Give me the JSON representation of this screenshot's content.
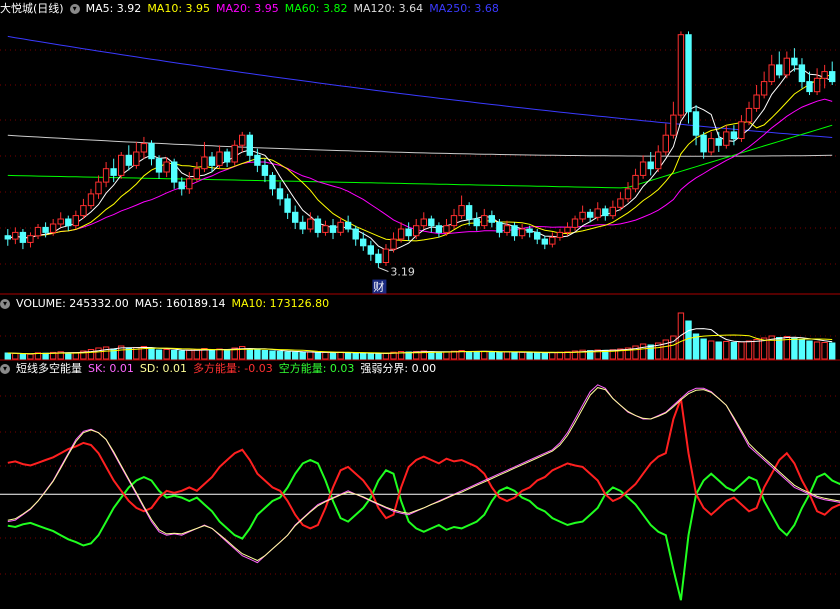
{
  "main": {
    "title": "大悦城(日线)",
    "legend": [
      {
        "label": "MA5: 3.92",
        "color": "#ffffff"
      },
      {
        "label": "MA10: 3.95",
        "color": "#ffff00"
      },
      {
        "label": "MA20: 3.95",
        "color": "#ff00ff"
      },
      {
        "label": "MA60: 3.82",
        "color": "#00ff00"
      },
      {
        "label": "MA120: 3.64",
        "color": "#dddddd"
      },
      {
        "label": "MA250: 3.68",
        "color": "#3a3aff"
      }
    ],
    "low_label": "3.19",
    "cai_label": "财"
  },
  "volume": {
    "title": "VOLUME: 245332.00",
    "ma5": "MA5: 160189.14",
    "ma10": "MA10: 173126.80"
  },
  "indicator": {
    "title": "短线多空能量",
    "sk": "SK: 0.01",
    "sd": "SD: 0.01",
    "duo": "多方能量: -0.03",
    "kong": "空方能量: 0.03",
    "qiang": "强弱分界: 0.00"
  },
  "colors": {
    "up": "#ff3030",
    "down": "#54ffff",
    "ma5": "#ffffff",
    "ma10": "#ffff00",
    "ma20": "#ff00ff",
    "ma60": "#00ff00",
    "ma120": "#cccccc",
    "ma250": "#3a3aff",
    "grid": "#7a0000",
    "duo": "#ff2020",
    "kong": "#20ff20",
    "sk": "#ff66ff",
    "sd": "#ffff99",
    "zero": "#ffffff"
  },
  "chart_data": {
    "type": "candlestick",
    "candles": [
      [
        3.38,
        3.36,
        3.42,
        3.32
      ],
      [
        3.36,
        3.4,
        3.43,
        3.33
      ],
      [
        3.4,
        3.34,
        3.42,
        3.3
      ],
      [
        3.34,
        3.38,
        3.4,
        3.31
      ],
      [
        3.38,
        3.43,
        3.45,
        3.36
      ],
      [
        3.43,
        3.4,
        3.46,
        3.37
      ],
      [
        3.4,
        3.45,
        3.48,
        3.38
      ],
      [
        3.45,
        3.48,
        3.52,
        3.43
      ],
      [
        3.48,
        3.44,
        3.5,
        3.41
      ],
      [
        3.44,
        3.5,
        3.53,
        3.42
      ],
      [
        3.5,
        3.56,
        3.6,
        3.48
      ],
      [
        3.56,
        3.63,
        3.66,
        3.54
      ],
      [
        3.63,
        3.7,
        3.74,
        3.6
      ],
      [
        3.7,
        3.78,
        3.82,
        3.67
      ],
      [
        3.78,
        3.74,
        3.84,
        3.7
      ],
      [
        3.74,
        3.86,
        3.88,
        3.72
      ],
      [
        3.86,
        3.8,
        3.92,
        3.77
      ],
      [
        3.8,
        3.88,
        3.94,
        3.78
      ],
      [
        3.88,
        3.93,
        3.97,
        3.84
      ],
      [
        3.93,
        3.84,
        3.95,
        3.8
      ],
      [
        3.84,
        3.76,
        3.86,
        3.72
      ],
      [
        3.76,
        3.82,
        3.85,
        3.73
      ],
      [
        3.82,
        3.7,
        3.84,
        3.66
      ],
      [
        3.7,
        3.66,
        3.73,
        3.62
      ],
      [
        3.66,
        3.72,
        3.76,
        3.63
      ],
      [
        3.72,
        3.78,
        3.82,
        3.7
      ],
      [
        3.78,
        3.85,
        3.94,
        3.76
      ],
      [
        3.85,
        3.8,
        3.88,
        3.76
      ],
      [
        3.8,
        3.88,
        3.92,
        3.78
      ],
      [
        3.88,
        3.82,
        3.9,
        3.79
      ],
      [
        3.82,
        3.92,
        3.95,
        3.8
      ],
      [
        3.92,
        3.98,
        4.0,
        3.88
      ],
      [
        3.98,
        3.86,
        4.0,
        3.82
      ],
      [
        3.86,
        3.8,
        3.9,
        3.76
      ],
      [
        3.8,
        3.74,
        3.84,
        3.7
      ],
      [
        3.74,
        3.66,
        3.76,
        3.62
      ],
      [
        3.66,
        3.6,
        3.7,
        3.56
      ],
      [
        3.6,
        3.52,
        3.63,
        3.48
      ],
      [
        3.52,
        3.46,
        3.56,
        3.42
      ],
      [
        3.46,
        3.42,
        3.5,
        3.39
      ],
      [
        3.42,
        3.48,
        3.52,
        3.4
      ],
      [
        3.48,
        3.4,
        3.5,
        3.37
      ],
      [
        3.4,
        3.44,
        3.47,
        3.38
      ],
      [
        3.44,
        3.4,
        3.48,
        3.36
      ],
      [
        3.4,
        3.46,
        3.49,
        3.38
      ],
      [
        3.46,
        3.42,
        3.5,
        3.4
      ],
      [
        3.42,
        3.36,
        3.44,
        3.32
      ],
      [
        3.36,
        3.32,
        3.4,
        3.29
      ],
      [
        3.32,
        3.27,
        3.35,
        3.23
      ],
      [
        3.27,
        3.22,
        3.3,
        3.19
      ],
      [
        3.22,
        3.3,
        3.33,
        3.2
      ],
      [
        3.3,
        3.36,
        3.4,
        3.28
      ],
      [
        3.36,
        3.42,
        3.46,
        3.34
      ],
      [
        3.42,
        3.38,
        3.46,
        3.35
      ],
      [
        3.38,
        3.44,
        3.48,
        3.36
      ],
      [
        3.44,
        3.48,
        3.52,
        3.42
      ],
      [
        3.48,
        3.44,
        3.5,
        3.4
      ],
      [
        3.44,
        3.4,
        3.46,
        3.37
      ],
      [
        3.4,
        3.44,
        3.48,
        3.38
      ],
      [
        3.44,
        3.5,
        3.54,
        3.42
      ],
      [
        3.5,
        3.56,
        3.62,
        3.48
      ],
      [
        3.56,
        3.48,
        3.58,
        3.44
      ],
      [
        3.48,
        3.44,
        3.52,
        3.41
      ],
      [
        3.44,
        3.5,
        3.54,
        3.42
      ],
      [
        3.5,
        3.46,
        3.53,
        3.43
      ],
      [
        3.46,
        3.4,
        3.48,
        3.37
      ],
      [
        3.4,
        3.44,
        3.47,
        3.38
      ],
      [
        3.44,
        3.38,
        3.46,
        3.35
      ],
      [
        3.38,
        3.42,
        3.45,
        3.36
      ],
      [
        3.42,
        3.4,
        3.44,
        3.37
      ],
      [
        3.4,
        3.36,
        3.42,
        3.33
      ],
      [
        3.36,
        3.33,
        3.38,
        3.3
      ],
      [
        3.33,
        3.37,
        3.4,
        3.31
      ],
      [
        3.37,
        3.4,
        3.42,
        3.35
      ],
      [
        3.4,
        3.43,
        3.46,
        3.38
      ],
      [
        3.43,
        3.48,
        3.5,
        3.41
      ],
      [
        3.48,
        3.52,
        3.56,
        3.46
      ],
      [
        3.52,
        3.49,
        3.54,
        3.46
      ],
      [
        3.49,
        3.54,
        3.58,
        3.47
      ],
      [
        3.54,
        3.5,
        3.56,
        3.47
      ],
      [
        3.5,
        3.55,
        3.59,
        3.48
      ],
      [
        3.55,
        3.6,
        3.64,
        3.53
      ],
      [
        3.6,
        3.66,
        3.7,
        3.58
      ],
      [
        3.66,
        3.74,
        3.78,
        3.64
      ],
      [
        3.74,
        3.82,
        3.86,
        3.72
      ],
      [
        3.82,
        3.78,
        3.88,
        3.74
      ],
      [
        3.78,
        3.88,
        3.92,
        3.76
      ],
      [
        3.88,
        3.98,
        4.05,
        3.86
      ],
      [
        3.98,
        4.1,
        4.18,
        3.96
      ],
      [
        4.1,
        4.58,
        4.6,
        4.08
      ],
      [
        4.58,
        4.12,
        4.6,
        4.05
      ],
      [
        4.12,
        3.98,
        4.16,
        3.92
      ],
      [
        3.98,
        3.88,
        4.0,
        3.84
      ],
      [
        3.88,
        3.96,
        4.0,
        3.86
      ],
      [
        3.96,
        3.92,
        4.0,
        3.88
      ],
      [
        3.92,
        4.0,
        4.04,
        3.9
      ],
      [
        4.0,
        3.96,
        4.04,
        3.92
      ],
      [
        3.96,
        4.06,
        4.1,
        3.94
      ],
      [
        4.06,
        4.14,
        4.18,
        4.04
      ],
      [
        4.14,
        4.22,
        4.28,
        4.12
      ],
      [
        4.22,
        4.3,
        4.36,
        4.2
      ],
      [
        4.3,
        4.4,
        4.46,
        4.28
      ],
      [
        4.4,
        4.34,
        4.48,
        4.32
      ],
      [
        4.34,
        4.44,
        4.48,
        4.32
      ],
      [
        4.44,
        4.4,
        4.5,
        4.36
      ],
      [
        4.4,
        4.3,
        4.44,
        4.26
      ],
      [
        4.3,
        4.24,
        4.36,
        4.22
      ],
      [
        4.24,
        4.32,
        4.38,
        4.22
      ],
      [
        4.32,
        4.36,
        4.4,
        4.26
      ],
      [
        4.36,
        4.3,
        4.42,
        4.28
      ]
    ],
    "volume": [
      60,
      55,
      50,
      48,
      62,
      58,
      66,
      72,
      60,
      64,
      80,
      95,
      110,
      120,
      100,
      130,
      105,
      115,
      125,
      100,
      90,
      95,
      85,
      80,
      88,
      92,
      105,
      90,
      100,
      88,
      110,
      125,
      100,
      90,
      85,
      80,
      75,
      70,
      68,
      65,
      70,
      62,
      66,
      60,
      68,
      64,
      58,
      55,
      52,
      50,
      60,
      68,
      75,
      70,
      74,
      80,
      72,
      66,
      70,
      78,
      85,
      75,
      70,
      76,
      72,
      66,
      70,
      64,
      68,
      66,
      62,
      58,
      64,
      68,
      72,
      80,
      88,
      84,
      90,
      86,
      92,
      100,
      110,
      130,
      150,
      140,
      160,
      190,
      230,
      460,
      380,
      250,
      200,
      180,
      170,
      175,
      165,
      170,
      180,
      195,
      210,
      230,
      215,
      225,
      205,
      190,
      180,
      170,
      165,
      160
    ],
    "duo": [
      0.46,
      0.48,
      0.44,
      0.42,
      0.46,
      0.5,
      0.54,
      0.6,
      0.66,
      0.7,
      0.75,
      0.72,
      0.6,
      0.4,
      0.2,
      0.05,
      -0.1,
      -0.2,
      -0.25,
      -0.2,
      -0.05,
      0.05,
      0.02,
      0.05,
      0.1,
      0.05,
      0.15,
      0.25,
      0.4,
      0.5,
      0.6,
      0.65,
      0.5,
      0.3,
      0.2,
      0.1,
      0.05,
      -0.1,
      -0.3,
      -0.45,
      -0.5,
      -0.45,
      -0.2,
      0.1,
      0.35,
      0.4,
      0.3,
      0.2,
      0.05,
      -0.2,
      -0.35,
      -0.3,
      0.1,
      0.4,
      0.5,
      0.55,
      0.5,
      0.45,
      0.52,
      0.48,
      0.5,
      0.45,
      0.4,
      0.3,
      0.1,
      -0.05,
      -0.1,
      -0.05,
      0.05,
      0.1,
      0.2,
      0.25,
      0.35,
      0.4,
      0.45,
      0.42,
      0.4,
      0.3,
      0.2,
      0.0,
      -0.1,
      -0.05,
      0.05,
      0.15,
      0.3,
      0.45,
      0.55,
      0.6,
      1.1,
      1.4,
      0.6,
      0.0,
      -0.2,
      -0.3,
      -0.2,
      -0.1,
      -0.05,
      -0.15,
      -0.25,
      -0.2,
      0.1,
      0.3,
      0.5,
      0.6,
      0.45,
      0.2,
      0.0,
      -0.25,
      -0.3,
      -0.2,
      -0.15,
      -0.25
    ],
    "kong": [
      -0.46,
      -0.48,
      -0.44,
      -0.42,
      -0.46,
      -0.5,
      -0.54,
      -0.6,
      -0.66,
      -0.7,
      -0.75,
      -0.72,
      -0.6,
      -0.4,
      -0.2,
      -0.05,
      0.1,
      0.2,
      0.25,
      0.2,
      0.05,
      -0.05,
      -0.02,
      -0.05,
      -0.1,
      -0.05,
      -0.15,
      -0.25,
      -0.4,
      -0.5,
      -0.6,
      -0.65,
      -0.5,
      -0.3,
      -0.2,
      -0.1,
      -0.05,
      0.1,
      0.3,
      0.45,
      0.5,
      0.45,
      0.2,
      -0.1,
      -0.35,
      -0.4,
      -0.3,
      -0.2,
      -0.05,
      0.2,
      0.35,
      0.3,
      -0.1,
      -0.4,
      -0.5,
      -0.55,
      -0.5,
      -0.45,
      -0.52,
      -0.48,
      -0.5,
      -0.45,
      -0.4,
      -0.3,
      -0.1,
      0.05,
      0.1,
      0.05,
      -0.05,
      -0.1,
      -0.2,
      -0.25,
      -0.35,
      -0.4,
      -0.45,
      -0.42,
      -0.4,
      -0.3,
      -0.2,
      0.0,
      0.1,
      0.05,
      -0.05,
      -0.15,
      -0.3,
      -0.45,
      -0.55,
      -0.6,
      -1.1,
      -1.55,
      -0.6,
      0.0,
      0.2,
      0.3,
      0.2,
      0.1,
      0.05,
      0.15,
      0.25,
      0.2,
      -0.1,
      -0.3,
      -0.5,
      -0.6,
      -0.45,
      -0.2,
      0.0,
      0.25,
      0.3,
      0.2,
      0.15,
      0.25
    ],
    "sk": [
      -0.4,
      -0.38,
      -0.3,
      -0.22,
      -0.1,
      0.05,
      0.2,
      0.4,
      0.6,
      0.8,
      0.92,
      0.95,
      0.9,
      0.8,
      0.6,
      0.4,
      0.2,
      0.0,
      -0.2,
      -0.4,
      -0.55,
      -0.6,
      -0.58,
      -0.6,
      -0.55,
      -0.5,
      -0.45,
      -0.5,
      -0.6,
      -0.7,
      -0.8,
      -0.9,
      -0.95,
      -1.0,
      -0.9,
      -0.8,
      -0.7,
      -0.6,
      -0.45,
      -0.35,
      -0.25,
      -0.15,
      -0.1,
      -0.05,
      0.0,
      0.05,
      0.0,
      -0.05,
      -0.1,
      -0.15,
      -0.2,
      -0.25,
      -0.28,
      -0.3,
      -0.25,
      -0.2,
      -0.15,
      -0.1,
      -0.05,
      0.0,
      0.05,
      0.1,
      0.15,
      0.2,
      0.25,
      0.3,
      0.35,
      0.4,
      0.45,
      0.5,
      0.55,
      0.6,
      0.65,
      0.75,
      0.9,
      1.1,
      1.3,
      1.5,
      1.6,
      1.55,
      1.4,
      1.3,
      1.2,
      1.15,
      1.1,
      1.1,
      1.15,
      1.2,
      1.3,
      1.4,
      1.5,
      1.55,
      1.55,
      1.5,
      1.4,
      1.3,
      1.1,
      0.9,
      0.7,
      0.6,
      0.5,
      0.4,
      0.3,
      0.2,
      0.1,
      0.05,
      0.0,
      -0.05,
      -0.08,
      -0.1,
      -0.12,
      -0.15
    ],
    "sd": [
      -0.38,
      -0.36,
      -0.29,
      -0.21,
      -0.1,
      0.04,
      0.19,
      0.38,
      0.58,
      0.77,
      0.9,
      0.94,
      0.9,
      0.8,
      0.62,
      0.42,
      0.22,
      0.02,
      -0.18,
      -0.37,
      -0.52,
      -0.58,
      -0.57,
      -0.58,
      -0.54,
      -0.5,
      -0.46,
      -0.5,
      -0.59,
      -0.68,
      -0.78,
      -0.87,
      -0.92,
      -0.97,
      -0.9,
      -0.8,
      -0.7,
      -0.6,
      -0.46,
      -0.36,
      -0.26,
      -0.17,
      -0.11,
      -0.06,
      -0.01,
      0.03,
      0.0,
      -0.04,
      -0.09,
      -0.14,
      -0.19,
      -0.23,
      -0.26,
      -0.28,
      -0.24,
      -0.2,
      -0.15,
      -0.11,
      -0.06,
      -0.01,
      0.03,
      0.08,
      0.13,
      0.18,
      0.23,
      0.28,
      0.33,
      0.38,
      0.43,
      0.48,
      0.53,
      0.58,
      0.63,
      0.72,
      0.86,
      1.05,
      1.25,
      1.45,
      1.56,
      1.53,
      1.4,
      1.3,
      1.21,
      1.15,
      1.11,
      1.1,
      1.14,
      1.19,
      1.28,
      1.38,
      1.47,
      1.52,
      1.53,
      1.49,
      1.4,
      1.3,
      1.12,
      0.93,
      0.74,
      0.63,
      0.53,
      0.43,
      0.33,
      0.23,
      0.13,
      0.07,
      0.02,
      -0.03,
      -0.06,
      -0.08,
      -0.1,
      -0.13
    ]
  }
}
